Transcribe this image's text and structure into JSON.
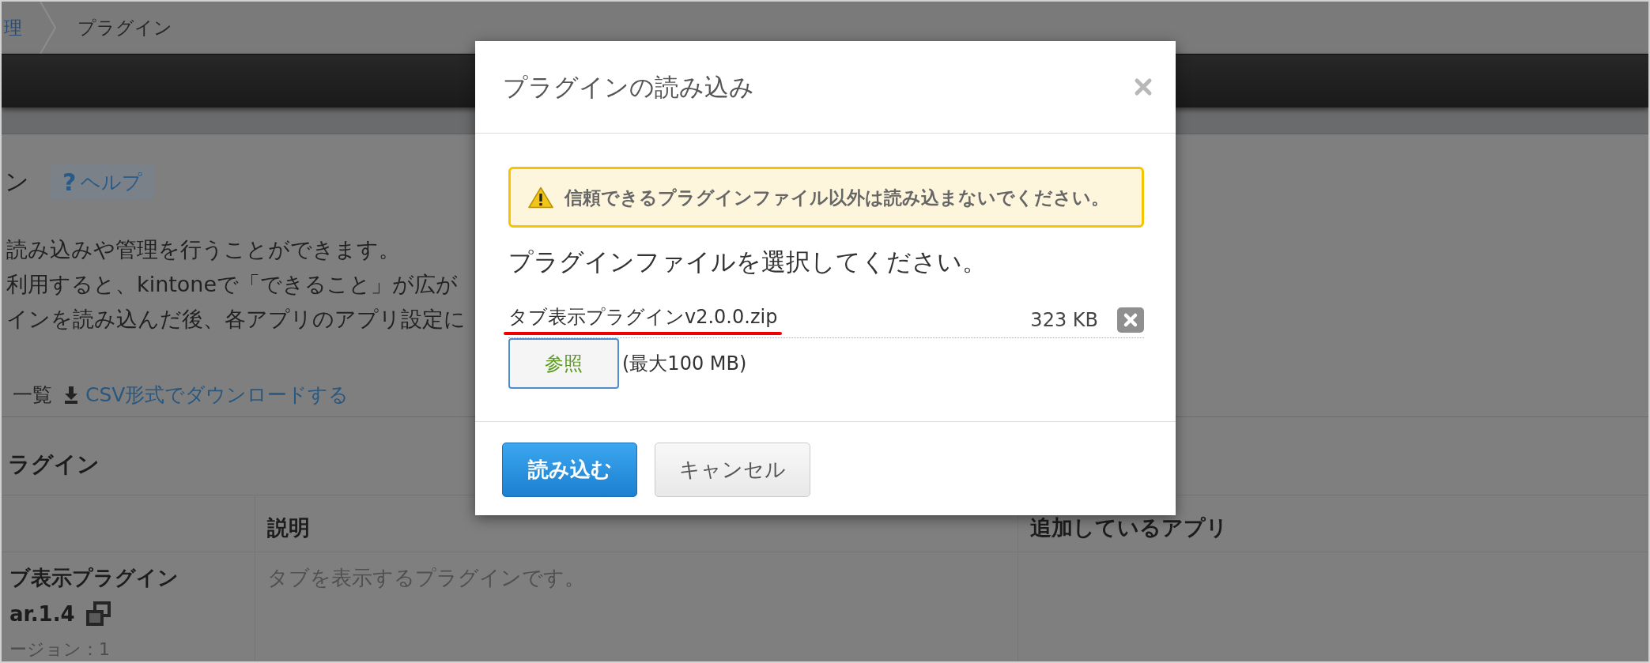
{
  "breadcrumb": {
    "items": [
      {
        "label": "理",
        "current": false
      },
      {
        "label": "プラグイン",
        "current": true
      }
    ]
  },
  "page": {
    "title": "ン",
    "help_button": {
      "icon": "?",
      "label": "ヘルプ"
    },
    "description": [
      "読み込みや管理を行うことができます。",
      "利用すると、kintoneで「できること」が広が",
      "インを読み込んだ後、各アプリのアプリ設定に"
    ],
    "list_label": "一覧",
    "download_link": "CSV形式でダウンロードする",
    "section_title": "ラグイン"
  },
  "table": {
    "columns": [
      "説明",
      "追加しているアプリ"
    ],
    "rows": [
      {
        "name": "ブ表示プラグイン",
        "version": "ar.1.4",
        "version_note": "ージョン：1",
        "description": "タブを表示するプラグインです。"
      }
    ]
  },
  "dialog": {
    "title": "プラグインの読み込み",
    "warning": "信頼できるプラグインファイル以外は読み込まないでください。",
    "prompt": "プラグインファイルを選択してください。",
    "file": {
      "name": "タブ表示プラグインv2.0.0.zip",
      "size": "323 KB",
      "underlined": true
    },
    "browse_button": "参照",
    "size_limit": "(最大100 MB)",
    "buttons": [
      {
        "label": "読み込む",
        "kind": "primary"
      },
      {
        "label": "キャンセル",
        "kind": "secondary"
      }
    ]
  }
}
